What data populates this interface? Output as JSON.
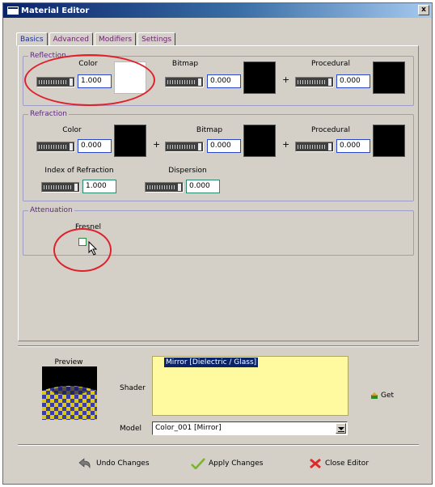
{
  "window": {
    "title": "Material Editor",
    "close_glyph": "x"
  },
  "tabs": [
    {
      "label": "Basics",
      "active": true
    },
    {
      "label": "Advanced",
      "active": false
    },
    {
      "label": "Modifiers",
      "active": false
    },
    {
      "label": "Settings",
      "active": false
    }
  ],
  "reflection": {
    "legend": "Reflection",
    "color_label": "Color",
    "color_value": "1.000",
    "bitmap_label": "Bitmap",
    "bitmap_value": "0.000",
    "procedural_label": "Procedural",
    "procedural_value": "0.000",
    "plus": "+"
  },
  "refraction": {
    "legend": "Refraction",
    "color_label": "Color",
    "color_value": "0.000",
    "bitmap_label": "Bitmap",
    "bitmap_value": "0.000",
    "procedural_label": "Procedural",
    "procedural_value": "0.000",
    "plus": "+",
    "ior_label": "Index of Refraction",
    "ior_value": "1.000",
    "dispersion_label": "Dispersion",
    "dispersion_value": "0.000"
  },
  "attenuation": {
    "legend": "Attenuation",
    "fresnel_label": "Fresnel",
    "fresnel_checked": false
  },
  "preview": {
    "label": "Preview"
  },
  "shader": {
    "label": "Shader",
    "selected_item": "Mirror [Dielectric / Glass]",
    "get_label": "Get"
  },
  "model": {
    "label": "Model",
    "value": "Color_001 [Mirror]"
  },
  "actions": {
    "undo_label": "Undo Changes",
    "apply_label": "Apply Changes",
    "close_label": "Close Editor"
  },
  "colors": {
    "titlebar": "#0a246a",
    "panel": "#d4d0c8",
    "annotation_red": "#e0202a",
    "shader_bg": "#fffaa0"
  }
}
